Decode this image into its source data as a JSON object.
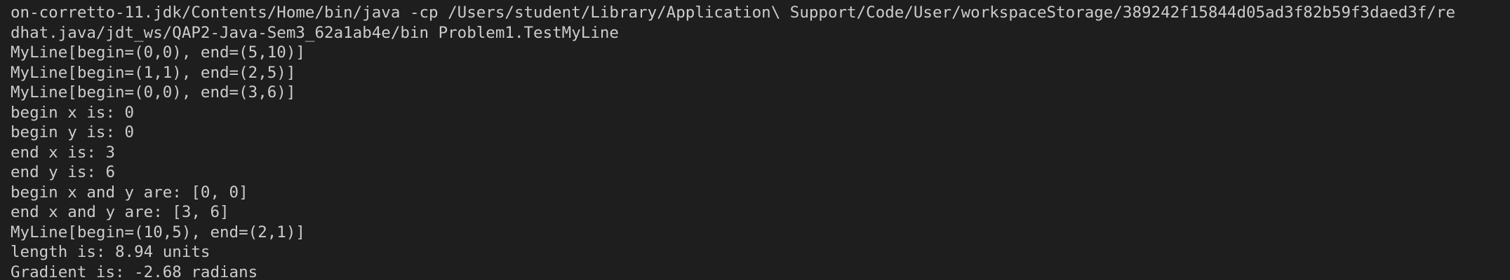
{
  "terminal": {
    "lines": [
      "on-corretto-11.jdk/Contents/Home/bin/java -cp /Users/student/Library/Application\\ Support/Code/User/workspaceStorage/389242f15844d05ad3f82b59f3daed3f/re",
      "dhat.java/jdt_ws/QAP2-Java-Sem3_62a1ab4e/bin Problem1.TestMyLine",
      "MyLine[begin=(0,0), end=(5,10)]",
      "MyLine[begin=(1,1), end=(2,5)]",
      "MyLine[begin=(0,0), end=(3,6)]",
      "begin x is: 0",
      "begin y is: 0",
      "end x is: 3",
      "end y is: 6",
      "begin x and y are: [0, 0]",
      "end x and y are: [3, 6]",
      "MyLine[begin=(10,5), end=(2,1)]",
      "length is: 8.94 units",
      "Gradient is: -2.68 radians"
    ],
    "colors": {
      "background": "#1e1e1e",
      "text": "#cccccc"
    }
  }
}
